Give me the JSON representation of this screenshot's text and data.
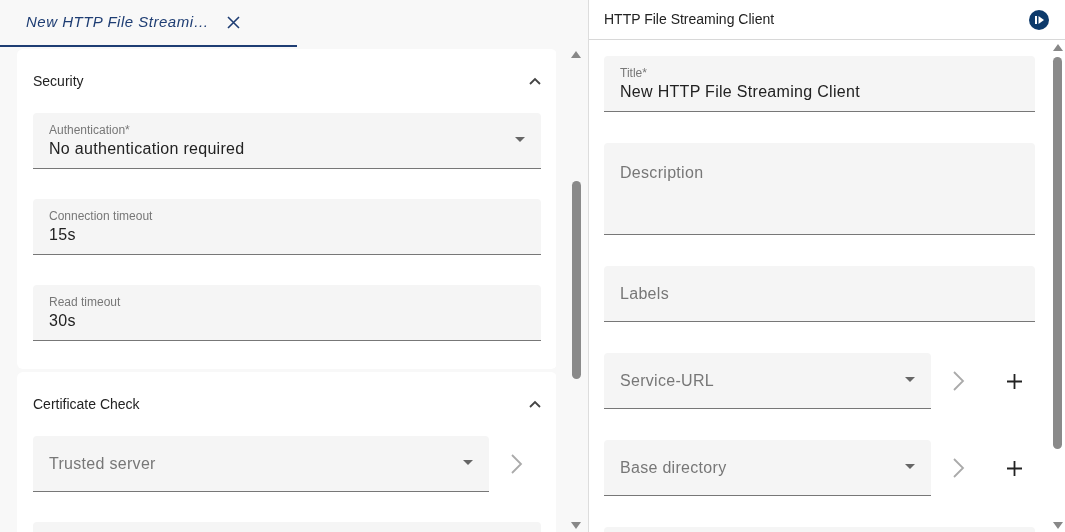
{
  "tabs": [
    {
      "label": "New HTTP File Streami…",
      "selected": true
    }
  ],
  "left": {
    "sections": [
      {
        "title": "Security",
        "expanded": true,
        "fields": [
          {
            "kind": "select",
            "label": "Authentication*",
            "value": "No authentication required"
          },
          {
            "kind": "text",
            "label": "Connection timeout",
            "value": "15s"
          },
          {
            "kind": "text",
            "label": "Read timeout",
            "value": "30s"
          }
        ]
      },
      {
        "title": "Certificate Check",
        "expanded": true,
        "fields": [
          {
            "kind": "select",
            "label": "Trusted server",
            "link": true
          },
          {
            "kind": "blank"
          }
        ]
      }
    ]
  },
  "right": {
    "title": "HTTP File Streaming Client",
    "fields": [
      {
        "kind": "text",
        "label": "Title*",
        "value": "New HTTP File Streaming Client"
      },
      {
        "kind": "textarea",
        "label": "Description"
      },
      {
        "kind": "text",
        "label": "Labels"
      },
      {
        "kind": "select",
        "label": "Service-URL",
        "link": true,
        "add": true
      },
      {
        "kind": "select",
        "label": "Base directory",
        "link": true,
        "add": true
      },
      {
        "kind": "blank"
      }
    ]
  }
}
